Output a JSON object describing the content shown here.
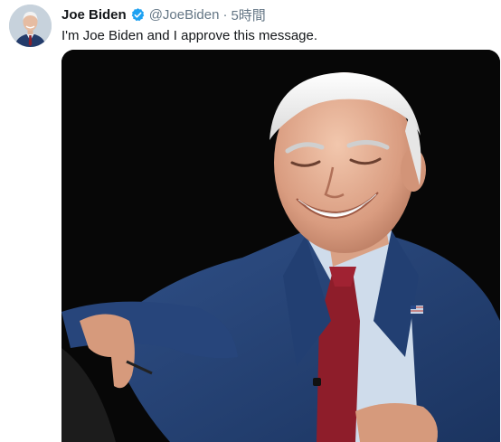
{
  "tweet": {
    "display_name": "Joe Biden",
    "handle": "@JoeBiden",
    "separator": "·",
    "time": "5時間",
    "text": "I'm Joe Biden and I approve this message."
  },
  "colors": {
    "verified_badge": "#1da1f2",
    "handle_gray": "#657786",
    "text_black": "#14171a",
    "media_background": "#070707"
  },
  "icons": {
    "verified": "verified-badge-icon"
  }
}
